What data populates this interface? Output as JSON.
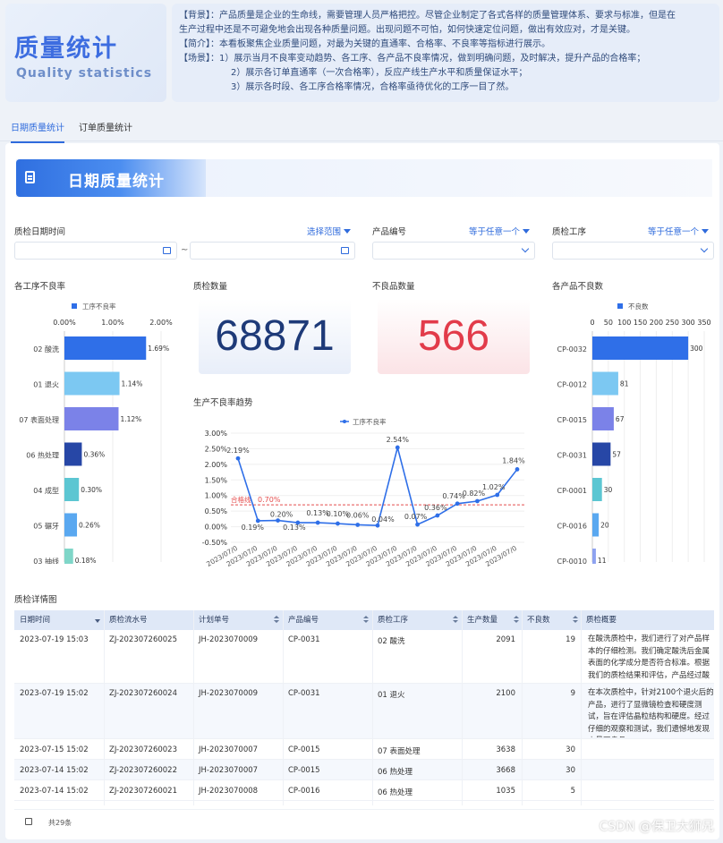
{
  "header": {
    "title": "质量统计",
    "subtitle": "Quality statistics",
    "lines": [
      {
        "tag": "【背景】",
        "text": "：产品质量是企业的生命线，需要管理人员严格把控。尽管企业制定了各式各样的质量管理体系、要求与标准，但是在"
      },
      {
        "tag": "",
        "text": "生产过程中还是不可避免地会出现各种质量问题。出现问题不可怕，如何快速定位问题，做出有效应对，才是关键。"
      },
      {
        "tag": "【简介】",
        "text": "：本看板聚焦企业质量问题，对最为关键的直通率、合格率、不良率等指标进行展示。"
      },
      {
        "tag": "【场景】",
        "text": "：1）展示当月不良率变动趋势、各工序、各产品不良率情况，做到明确问题，及时解决，提升产品的合格率；"
      },
      {
        "tag": "",
        "text": "2）展示各订单直通率（一次合格率），反应产线生产水平和质量保证水平；"
      },
      {
        "tag": "",
        "text": "3）展示各时段、各工序合格率情况，合格率亟待优化的工序一目了然。"
      }
    ]
  },
  "tabs": [
    {
      "label": "日期质量统计",
      "active": true
    },
    {
      "label": "订单质量统计",
      "active": false
    }
  ],
  "banner": {
    "title": "日期质量统计"
  },
  "filters": {
    "date_label": "质检日期时间",
    "date_select": "选择范围",
    "date_sep": "~",
    "product_label": "产品编号",
    "product_select": "等于任意一个",
    "process_label": "质检工序",
    "process_select": "等于任意一个"
  },
  "kpis": {
    "inspect_title": "质检数量",
    "inspect_value": "68871",
    "defect_title": "不良品数量",
    "defect_value": "566"
  },
  "charts": {
    "process_title": "各工序不良率",
    "product_title": "各产品不良数",
    "trend_title": "生产不良率趋势"
  },
  "chart_data": [
    {
      "type": "bar",
      "orientation": "horizontal",
      "legend": [
        "工序不良率"
      ],
      "x_ticks": [
        "0.00%",
        "1.00%",
        "2.00%"
      ],
      "xlim": [
        0,
        2
      ],
      "categories": [
        "02 酸洗",
        "01 退火",
        "07 表面处理",
        "06 热处理",
        "04 成型",
        "05 碾牙",
        "03 抽线"
      ],
      "values": [
        1.69,
        1.14,
        1.12,
        0.36,
        0.3,
        0.26,
        0.18
      ],
      "labels": [
        "1.69%",
        "1.14%",
        "1.12%",
        "0.36%",
        "0.30%",
        "0.26%",
        "0.18%"
      ],
      "colors": [
        "#2f6fe8",
        "#7cc8f2",
        "#7b82e8",
        "#2747a6",
        "#5cc6d2",
        "#5aa8f0",
        "#7fd6c8"
      ]
    },
    {
      "type": "bar",
      "orientation": "horizontal",
      "legend": [
        "不良数"
      ],
      "x_ticks": [
        "0",
        "50",
        "100",
        "150",
        "200",
        "250",
        "300",
        "350"
      ],
      "xlim": [
        0,
        350
      ],
      "categories": [
        "CP-0032",
        "CP-0012",
        "CP-0015",
        "CP-0031",
        "CP-0001",
        "CP-0016",
        "CP-0010"
      ],
      "values": [
        300,
        81,
        67,
        57,
        30,
        20,
        11
      ],
      "colors": [
        "#2f6fe8",
        "#7cc8f2",
        "#7b82e8",
        "#2747a6",
        "#5cc6d2",
        "#5aa8f0",
        "#8ea2f0"
      ]
    },
    {
      "type": "line",
      "legend": [
        "工序不良率"
      ],
      "y_ticks": [
        "3.00%",
        "2.50%",
        "2.00%",
        "1.50%",
        "1.00%",
        "0.50%",
        "0.00%",
        "-0.50%"
      ],
      "ylim": [
        -0.5,
        3.0
      ],
      "x_tick_text": "2023/07/0",
      "values": [
        2.19,
        0.19,
        0.2,
        0.13,
        0.13,
        0.1,
        0.06,
        0.04,
        2.54,
        0.07,
        0.36,
        0.74,
        0.82,
        1.02,
        1.84
      ],
      "labels": [
        "2.19%",
        "0.19%",
        "0.20%",
        "0.13%",
        "0.13%",
        "0.10%",
        "0.06%",
        "0.04%",
        "2.54%",
        "0.07%",
        "0.36%",
        "0.74%",
        "0.82%",
        "1.02%",
        "1.84%"
      ],
      "threshold": {
        "label": "合格线",
        "value": 0.7,
        "value_label": "0.70%"
      }
    }
  ],
  "table": {
    "title": "质检详情图",
    "columns": [
      "日期时间",
      "质检流水号",
      "计划单号",
      "产品编号",
      "质检工序",
      "生产数量",
      "不良数",
      "质检概要"
    ],
    "rows": [
      {
        "datetime": "2023-07-19 15:03",
        "serial": "ZJ-202307260025",
        "plan": "JH-2023070009",
        "product": "CP-0031",
        "process": "02 酸洗",
        "qty": "2091",
        "defect": "19",
        "summary": "在酸洗质检中，我们进行了对产品样本的仔细检测。我们确定酸洗后金属表面的化学成分是否符合标准。根据我们的质检结果和评估，产品经过酸洗后达到要求。"
      },
      {
        "datetime": "2023-07-19 15:02",
        "serial": "ZJ-202307260024",
        "plan": "JH-2023070009",
        "product": "CP-0031",
        "process": "01 退火",
        "qty": "2100",
        "defect": "9",
        "summary": "在本次质检中，针对2100个退火后的产品，进行了显微镜检查和硬度测试，旨在评估晶粒结构和硬度。经过仔细的观察和测试，我们遗憾地发现少量不良品。"
      },
      {
        "datetime": "2023-07-15 15:02",
        "serial": "ZJ-202307260023",
        "plan": "JH-2023070007",
        "product": "CP-0015",
        "process": "07 表面处理",
        "qty": "3638",
        "defect": "30",
        "summary": ""
      },
      {
        "datetime": "2023-07-14 15:02",
        "serial": "ZJ-202307260022",
        "plan": "JH-2023070007",
        "product": "CP-0015",
        "process": "06 热处理",
        "qty": "3668",
        "defect": "30",
        "summary": ""
      },
      {
        "datetime": "2023-07-14 15:02",
        "serial": "ZJ-202307260021",
        "plan": "JH-2023070008",
        "product": "CP-0016",
        "process": "06 热处理",
        "qty": "1035",
        "defect": "5",
        "summary": ""
      }
    ],
    "total": "共29条"
  },
  "watermark": "CSDN @保卫大狮兄",
  "colors": {
    "accent": "#2f6bdc",
    "kpi_blue": "#1e3a78",
    "kpi_red": "#e23b4a",
    "line": "#2f6fe8",
    "threshold": "#e54d4d"
  }
}
